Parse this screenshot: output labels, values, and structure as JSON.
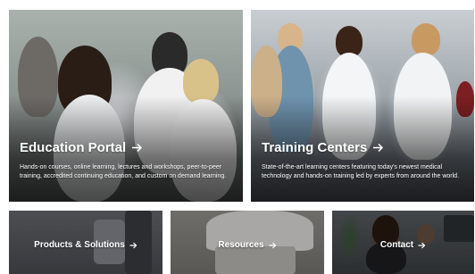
{
  "tiles_large": [
    {
      "title": "Education Portal",
      "description": "Hands-on courses, online learning, lectures and workshops, peer-to-peer training, accredited continuing education, and custom on demand learning.",
      "arrow_icon": "arrow-right-icon"
    },
    {
      "title": "Training Centers",
      "description": "State-of-the-art learning centers featuring today's newest medical technology and hands-on training led by experts from around the world.",
      "arrow_icon": "arrow-right-icon"
    }
  ],
  "tiles_small": [
    {
      "title": "Products & Solutions",
      "arrow_icon": "arrow-right-icon"
    },
    {
      "title": "Resources",
      "arrow_icon": "arrow-right-icon"
    },
    {
      "title": "Contact",
      "arrow_icon": "arrow-right-icon"
    }
  ],
  "colors": {
    "text": "#ffffff",
    "background": "#ffffff"
  }
}
